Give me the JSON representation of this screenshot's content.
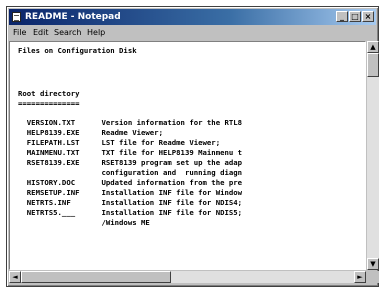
{
  "window": {
    "title": "README - Notepad",
    "controls": {
      "minimize": "_",
      "maximize": "□",
      "close": "×"
    }
  },
  "menu": [
    "File",
    "Edit",
    "Search",
    "Help"
  ],
  "document": {
    "lines": [
      "Files on Configuration Disk",
      "",
      "",
      "Root directory",
      "==============",
      "  VERSION.TXT      Version information for the RTL8",
      "  HELP8139.EXE     Readme Viewer;",
      "  FILEPATH.LST     LST file for Readme Viewer;",
      "  MAINMENU.TXT     TXT file for HELP8139 Mainmenu t",
      "  RSET8139.EXE     RSET8139 program set up the adap",
      "                   configuration and  running diagn",
      "  HISTORY.DOC      Updated information from the pre",
      "  REMSETUP.INF     Installation INF file for Window",
      "  NETRTS.INF       Installation INF file for NDIS4;",
      "  NETRTS5.___      Installation INF file for NDIS5;",
      "                   /Windows ME"
    ]
  },
  "scrollbars": {
    "up_arrow": "▲",
    "down_arrow": "▼",
    "left_arrow": "◄",
    "right_arrow": "►"
  }
}
